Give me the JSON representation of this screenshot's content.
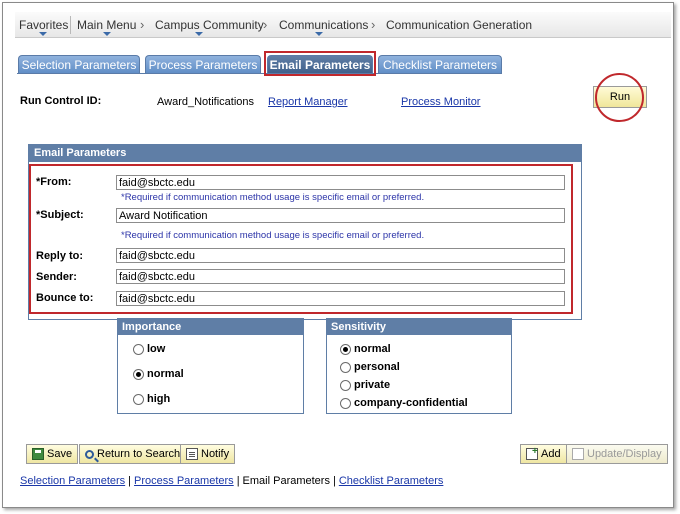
{
  "nav": {
    "items": [
      "Favorites",
      "Main Menu",
      "Campus Community",
      "Communications",
      "Communication Generation"
    ]
  },
  "tabs": [
    "Selection Parameters",
    "Process Parameters",
    "Email Parameters",
    "Checklist Parameters"
  ],
  "active_tab": "Email Parameters",
  "run_control": {
    "label": "Run Control ID:",
    "value": "Award_Notifications",
    "report_manager": "Report Manager",
    "process_monitor": "Process Monitor",
    "run_button": "Run"
  },
  "email_params": {
    "header": "Email Parameters",
    "from_label": "*From:",
    "from_value": "faid@sbctc.edu",
    "from_hint": "*Required if communication method usage is specific email or preferred.",
    "subject_label": "*Subject:",
    "subject_value": "Award Notification",
    "subject_hint": "*Required if communication method usage is specific email or preferred.",
    "reply_label": "Reply to:",
    "reply_value": "faid@sbctc.edu",
    "sender_label": "Sender:",
    "sender_value": "faid@sbctc.edu",
    "bounce_label": "Bounce to:",
    "bounce_value": "faid@sbctc.edu"
  },
  "importance": {
    "header": "Importance",
    "options": [
      "low",
      "normal",
      "high"
    ],
    "selected": "normal"
  },
  "sensitivity": {
    "header": "Sensitivity",
    "options": [
      "normal",
      "personal",
      "private",
      "company-confidential"
    ],
    "selected": "normal"
  },
  "buttons": {
    "save": "Save",
    "return_to_search": "Return to Search",
    "notify": "Notify",
    "add": "Add",
    "update_display": "Update/Display"
  },
  "footer_links": [
    "Selection Parameters",
    "Process Parameters",
    "Email Parameters",
    "Checklist Parameters"
  ],
  "colors": {
    "tab_blue": "#5e8cc5",
    "panel_header": "#5f7ea6",
    "highlight_red": "#c0282c",
    "button_yellow": "#f0e69a",
    "link_blue": "#1a37a8"
  }
}
